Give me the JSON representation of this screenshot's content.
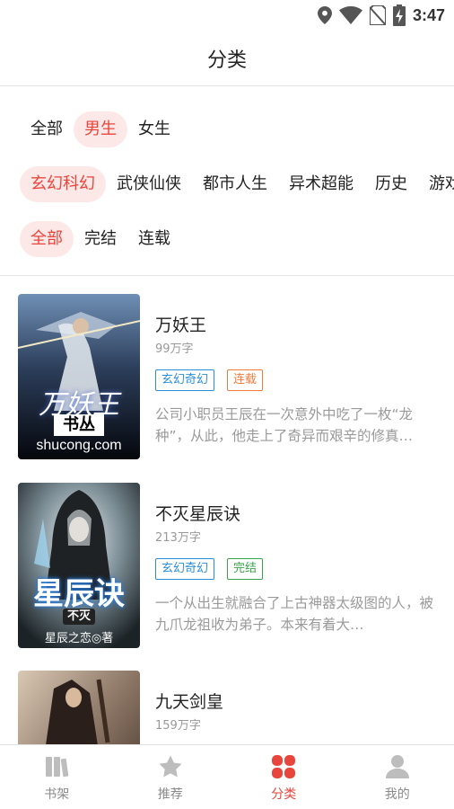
{
  "status_bar": {
    "time": "3:47"
  },
  "header": {
    "title": "分类"
  },
  "filters": {
    "gender": [
      {
        "label": "全部",
        "active": false
      },
      {
        "label": "男生",
        "active": true
      },
      {
        "label": "女生",
        "active": false
      }
    ],
    "genre": [
      {
        "label": "玄幻科幻",
        "active": true
      },
      {
        "label": "武侠仙侠",
        "active": false
      },
      {
        "label": "都市人生",
        "active": false
      },
      {
        "label": "异术超能",
        "active": false
      },
      {
        "label": "历史",
        "active": false
      },
      {
        "label": "游戏",
        "active": false
      }
    ],
    "status": [
      {
        "label": "全部",
        "active": true
      },
      {
        "label": "完结",
        "active": false
      },
      {
        "label": "连载",
        "active": false
      }
    ]
  },
  "books": [
    {
      "title": "万妖王",
      "word_count": "99万字",
      "genre_tag": "玄幻奇幻",
      "status_tag": "连载",
      "description": "公司小职员王辰在一次意外中吃了一枚“龙种”，从此，他走上了奇异而艰辛的修真…",
      "cover_text": "万妖王",
      "cover_sub": "书丛",
      "cover_site": "shucong.com"
    },
    {
      "title": "不灭星辰诀",
      "word_count": "213万字",
      "genre_tag": "玄幻奇幻",
      "status_tag": "完结",
      "description": "一个从出生就融合了上古神器太级图的人，被九爪龙祖收为弟子。本来有着大…",
      "cover_text": "星辰诀",
      "cover_sub": "不灭",
      "cover_author": "星辰之恋◎著"
    },
    {
      "title": "九天剑皇",
      "word_count": "159万字"
    }
  ],
  "tab_bar": [
    {
      "label": "书架",
      "icon": "bookshelf-icon",
      "active": false
    },
    {
      "label": "推荐",
      "icon": "star-icon",
      "active": false
    },
    {
      "label": "分类",
      "icon": "category-icon",
      "active": true
    },
    {
      "label": "我的",
      "icon": "user-icon",
      "active": false
    }
  ],
  "colors": {
    "accent": "#e8453c",
    "chip_active_bg": "#fde8e8",
    "genre_tag": "#2b8fd8",
    "serial_tag": "#f07a3c",
    "done_tag": "#3aa34a"
  }
}
